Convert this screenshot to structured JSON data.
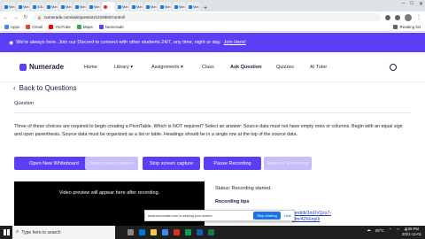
{
  "browser": {
    "tabs": [
      {
        "label": "Nun"
      },
      {
        "label": "Nun"
      },
      {
        "label": "SOL"
      },
      {
        "label": "Nun"
      },
      {
        "label": "Nun"
      },
      {
        "label": "Nun"
      },
      {
        "label": "Nun"
      },
      {
        "label": ""
      },
      {
        "label": "Nun"
      },
      {
        "label": "Nun"
      },
      {
        "label": "Nun"
      },
      {
        "label": "Nun"
      },
      {
        "label": "Nun"
      },
      {
        "label": "Nun"
      }
    ],
    "url": "numerade.com/ask/question/1219362/control/"
  },
  "bookmarks": {
    "items": [
      {
        "label": "Apps",
        "color": "#4285f4"
      },
      {
        "label": "Gmail",
        "color": "#ea4335"
      },
      {
        "label": "YouTube",
        "color": "#ff0000"
      },
      {
        "label": "Maps",
        "color": "#34a853"
      },
      {
        "label": "Numerade",
        "color": "#5b3ff6"
      }
    ],
    "reading_list": "Reading list"
  },
  "banner": {
    "text": "We're always here. Join our Discord to connect with other students 24/7, any time, night or day.",
    "link": "Join Here!"
  },
  "header": {
    "logo": "Numerade",
    "nav": [
      "Home",
      "Library ▾",
      "Assignments ▾",
      "Class",
      "Ask Question",
      "Quizzes",
      "AI Tutor"
    ]
  },
  "content": {
    "back_label": "Back to Questions",
    "question_label": "Question",
    "question_text": "Three of these choices are required to begin creating a PivotTable. Which is NOT required? Select an answer: Source data must not have empty rows or columns. Begin with an equal sign and open parenthesis. Source data must be organized as a list or table. Headings should be in a single row at the top of the source data.",
    "buttons": {
      "open_whiteboard": "Open New Whiteboard",
      "start_capture": "Start screen capture",
      "stop_capture": "Stop screen capture",
      "pause_recording": "Pause Recording",
      "resume_recording": "Resume Recording"
    },
    "video_placeholder": "Video preview will appear here after recording.",
    "status": "Status: Recording started.",
    "tips": "Recording tips",
    "clip_link_1": "nerd/di/3mUVQcx7-",
    "clip_link_2": "tdm/4ZhEnp0i"
  },
  "sharebar": {
    "message": "www.numerade.com is sharing your screen.",
    "stop": "Stop sharing",
    "hide": "Hide"
  },
  "taskbar": {
    "search_placeholder": "Type here to search",
    "weather": "28°C",
    "time": "3:29 PM",
    "date": "2021-12-01"
  }
}
